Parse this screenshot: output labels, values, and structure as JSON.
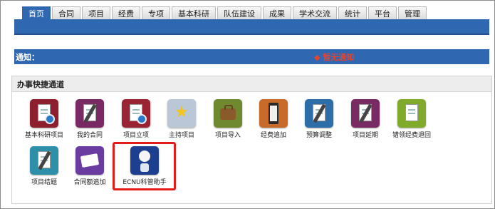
{
  "nav": {
    "tabs": [
      "首页",
      "合同",
      "项目",
      "经费",
      "专项",
      "基本科研",
      "队伍建设",
      "成果",
      "学术交流",
      "统计",
      "平台",
      "管理"
    ],
    "active_index": 0
  },
  "notice": {
    "label": "通知：",
    "message": "◆ 暂无通知"
  },
  "shortcuts_panel": {
    "title": "办事快捷通道",
    "items": [
      {
        "label": "基本科研项目",
        "icon": "document-disc-icon",
        "color": "#8e1f2e"
      },
      {
        "label": "我的合同",
        "icon": "contract-pen-icon",
        "color": "#7a2a62"
      },
      {
        "label": "项目立项",
        "icon": "document-disc-icon",
        "color": "#9a2334"
      },
      {
        "label": "主持项目",
        "icon": "folder-star-icon",
        "color": "#b9c7d6"
      },
      {
        "label": "项目导入",
        "icon": "briefcase-icon",
        "color": "#6f8a2e"
      },
      {
        "label": "经费追加",
        "icon": "clipboard-icon",
        "color": "#c86a2a"
      },
      {
        "label": "预算调整",
        "icon": "notepad-pen-icon",
        "color": "#2e6ea8"
      },
      {
        "label": "项目延期",
        "icon": "notepad-pen-icon",
        "color": "#7a2a62"
      },
      {
        "label": "错领经费退回",
        "icon": "notepad-icon",
        "color": "#7faa2a"
      },
      {
        "label": "项目结题",
        "icon": "notepad-pen-icon",
        "color": "#2e8fa8"
      },
      {
        "label": "合同额追加",
        "icon": "film-clip-icon",
        "color": "#6a3ca0"
      },
      {
        "label": "ECNU科管助手",
        "icon": "robot-assistant-icon",
        "color": "#1c3f8f"
      }
    ]
  },
  "colors": {
    "brand_blue": "#2f68b1",
    "notice_red": "#e2452f",
    "highlight_red": "#e21b1b"
  }
}
